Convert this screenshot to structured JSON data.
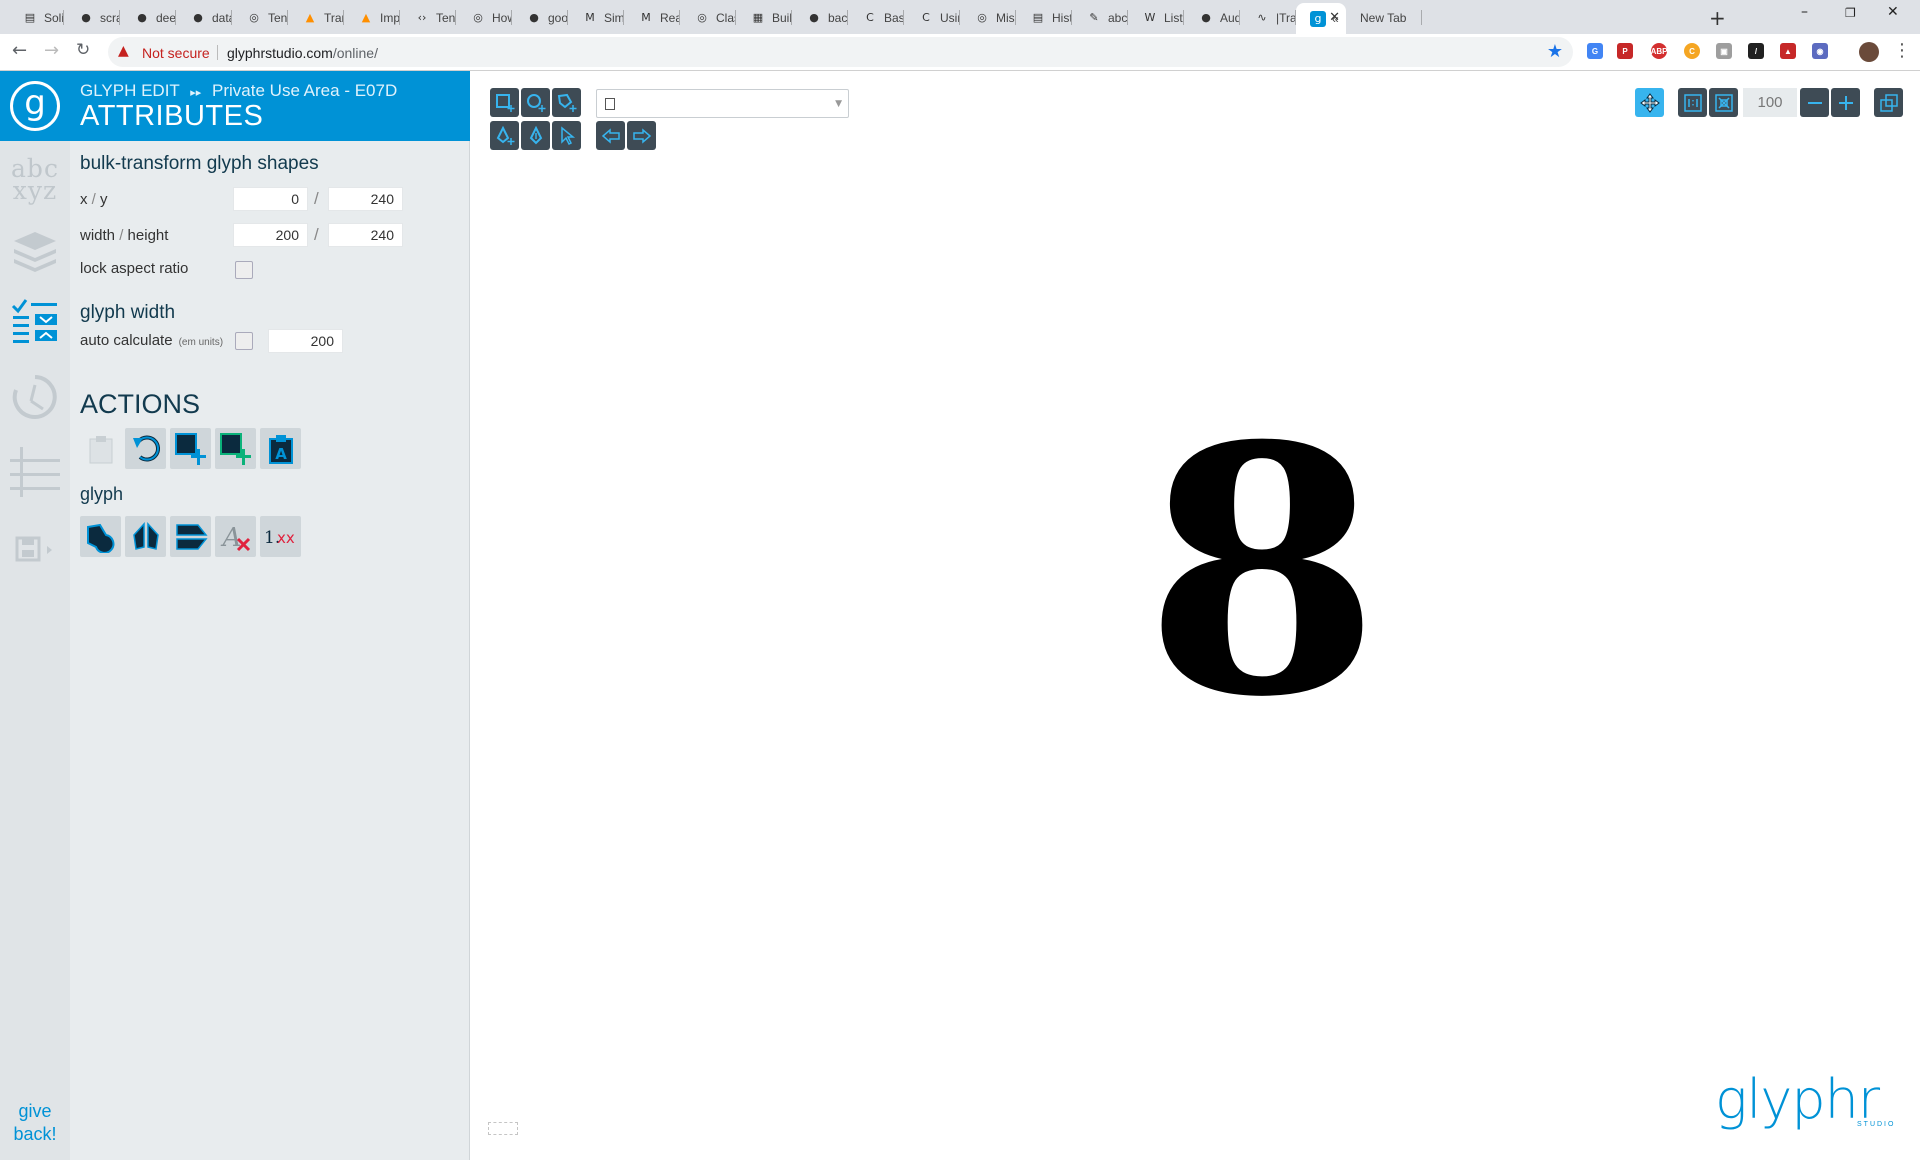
{
  "browser": {
    "tabs": [
      {
        "label": "Solid",
        "icon": "document-icon"
      },
      {
        "label": "scrap",
        "icon": "github-icon"
      },
      {
        "label": "deep",
        "icon": "github-icon"
      },
      {
        "label": "data-",
        "icon": "github-icon"
      },
      {
        "label": "Tenso",
        "icon": "globe-icon"
      },
      {
        "label": "Trans",
        "icon": "tensorflow-icon"
      },
      {
        "label": "Impo",
        "icon": "tensorflow-icon"
      },
      {
        "label": "Tenso",
        "icon": "code-icon"
      },
      {
        "label": "How",
        "icon": "globe-icon"
      },
      {
        "label": "goog",
        "icon": "github-icon"
      },
      {
        "label": "Simp",
        "icon": "medium-icon"
      },
      {
        "label": "Realt",
        "icon": "medium-icon"
      },
      {
        "label": "Class",
        "icon": "globe-icon"
      },
      {
        "label": "Build",
        "icon": "film-icon"
      },
      {
        "label": "bacti",
        "icon": "github-icon"
      },
      {
        "label": "Basic",
        "icon": "c-icon"
      },
      {
        "label": "Using",
        "icon": "c-icon"
      },
      {
        "label": "Misc",
        "icon": "globe-icon"
      },
      {
        "label": "Histo",
        "icon": "document-icon"
      },
      {
        "label": "abcs",
        "icon": "pencil-icon"
      },
      {
        "label": "List o",
        "icon": "wikipedia-icon"
      },
      {
        "label": "Audi",
        "icon": "github-icon"
      },
      {
        "label": "|Trac",
        "icon": "wave-icon"
      },
      {
        "label": "«",
        "icon": "glyphr-icon",
        "active": true
      },
      {
        "label": "New Tab",
        "icon": ""
      }
    ],
    "address": {
      "security": "Not secure",
      "url_host": "glyphrstudio.com",
      "url_path": "/online/"
    }
  },
  "rail": {
    "abc_top": "abc",
    "abc_bottom": "xyz",
    "give_back_1": "give",
    "give_back_2": "back!"
  },
  "panel": {
    "breadcrumb_mode": "GLYPH EDIT",
    "breadcrumb_arrows": "▸▸",
    "breadcrumb_glyph": "Private Use Area - E07D",
    "title": "ATTRIBUTES",
    "bulk_title": "bulk-transform glyph shapes",
    "xy_label_x": "x",
    "xy_label_y": "y",
    "wh_label_w": "width",
    "wh_label_h": "height",
    "slash": "/",
    "x": "0",
    "y": "240",
    "width": "200",
    "height": "240",
    "lock_aspect_label": "lock aspect ratio",
    "glyph_width_title": "glyph width",
    "auto_calculate_label": "auto calculate",
    "em_units_note": "(em units)",
    "glyph_width_value": "200",
    "actions_title": "ACTIONS",
    "glyph_section_title": "glyph"
  },
  "canvas": {
    "zoom_value": "100",
    "glyph_char": "8",
    "logo_text": "glyphr",
    "logo_sub": "STUDIO"
  },
  "colors": {
    "accent": "#0092d6",
    "tool_button": "#3e4b55",
    "tool_button_active": "#37b4ee",
    "panel_bg": "#e8ecee",
    "rail_bg": "#e0e4e7"
  }
}
